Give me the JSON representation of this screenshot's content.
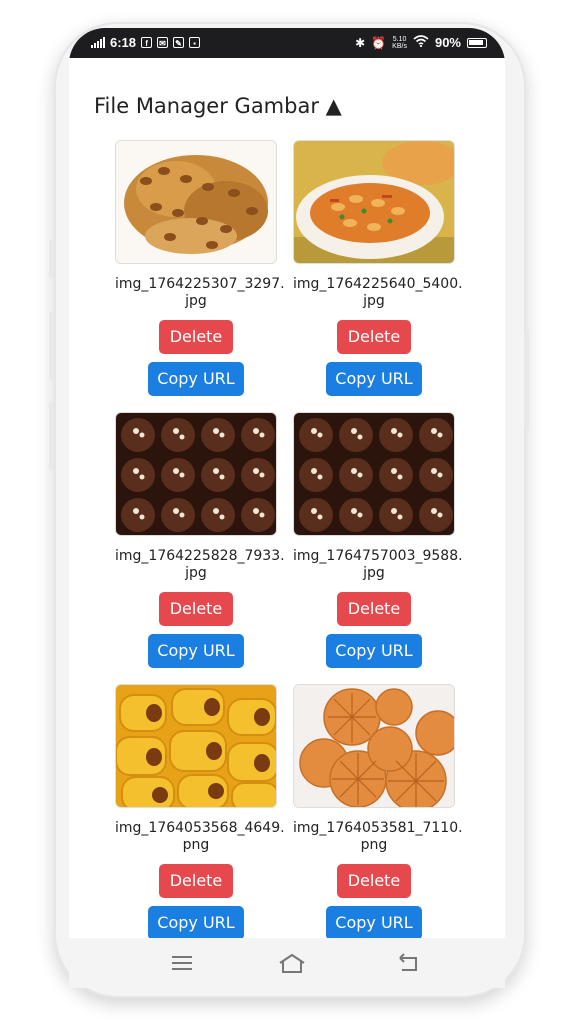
{
  "status": {
    "time": "6:18",
    "net_speed_top": "5.10",
    "net_speed_bottom": "KB/s",
    "battery": "90%"
  },
  "header": {
    "title": "File Manager Gambar ▲"
  },
  "files": [
    {
      "name": "img_1764225307_3297.\njpg",
      "image": "peanut-brittle",
      "delete_label": "Delete",
      "copy_label": "Copy URL"
    },
    {
      "name": "img_1764225640_5400.\njpg",
      "image": "spicy-nut-snack",
      "delete_label": "Delete",
      "copy_label": "Copy URL"
    },
    {
      "name": "img_1764225828_7933.\njpg",
      "image": "chocolate-pralines",
      "delete_label": "Delete",
      "copy_label": "Copy URL"
    },
    {
      "name": "img_1764757003_9588.\njpg",
      "image": "chocolate-pralines",
      "delete_label": "Delete",
      "copy_label": "Copy URL"
    },
    {
      "name": "img_1764053568_4649.\npng",
      "image": "pineapple-tarts",
      "delete_label": "Delete",
      "copy_label": "Copy URL"
    },
    {
      "name": "img_1764053581_7110.\npng",
      "image": "shell-cookies",
      "delete_label": "Delete",
      "copy_label": "Copy URL"
    }
  ],
  "colors": {
    "delete": "#e5484d",
    "copy": "#1a7fe0"
  }
}
